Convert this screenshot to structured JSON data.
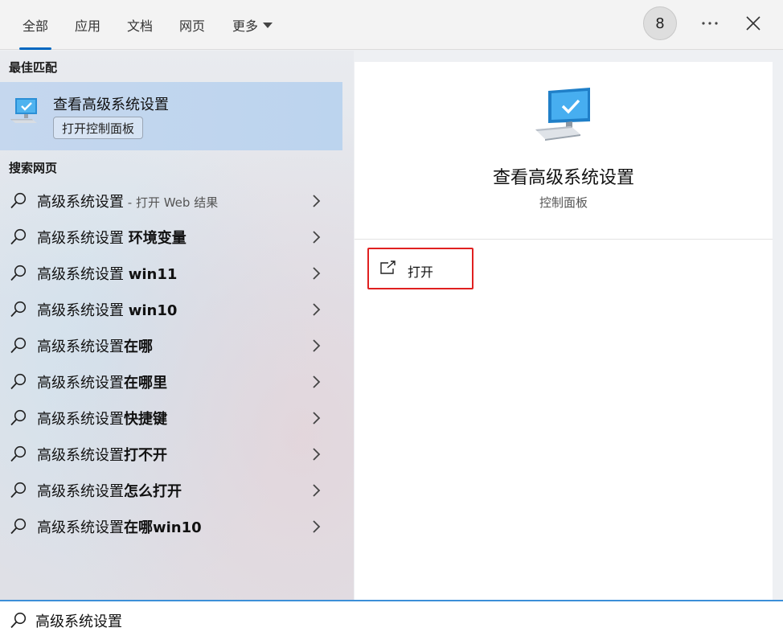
{
  "tabs": [
    {
      "label": "全部",
      "active": true
    },
    {
      "label": "应用",
      "active": false
    },
    {
      "label": "文档",
      "active": false
    },
    {
      "label": "网页",
      "active": false
    },
    {
      "label": "更多",
      "active": false
    }
  ],
  "header": {
    "account_badge": "8",
    "more_icon": "ellipsis-icon",
    "close_icon": "close-icon"
  },
  "best_match": {
    "section_title": "最佳匹配",
    "title": "查看高级系统设置",
    "subtitle": "打开控制面板",
    "icon": "monitor-check-icon"
  },
  "web_search": {
    "section_title": "搜索网页",
    "results": [
      {
        "prefix": "高级系统设置",
        "suffix": " - 打开 Web 结果",
        "bold": ""
      },
      {
        "prefix": "高级系统设置 ",
        "suffix": "",
        "bold": "环境变量"
      },
      {
        "prefix": "高级系统设置 ",
        "suffix": "",
        "bold": "win11"
      },
      {
        "prefix": "高级系统设置 ",
        "suffix": "",
        "bold": "win10"
      },
      {
        "prefix": "高级系统设置",
        "suffix": "",
        "bold": "在哪"
      },
      {
        "prefix": "高级系统设置",
        "suffix": "",
        "bold": "在哪里"
      },
      {
        "prefix": "高级系统设置",
        "suffix": "",
        "bold": "快捷键"
      },
      {
        "prefix": "高级系统设置",
        "suffix": "",
        "bold": "打不开"
      },
      {
        "prefix": "高级系统设置",
        "suffix": "",
        "bold": "怎么打开"
      },
      {
        "prefix": "高级系统设置",
        "suffix": "",
        "bold": "在哪win10"
      }
    ]
  },
  "detail": {
    "title": "查看高级系统设置",
    "subtitle": "控制面板",
    "open_label": "打开"
  },
  "search": {
    "value": "高级系统设置"
  },
  "colors": {
    "accent": "#0067c0",
    "highlight_box": "#e02020",
    "selected_bg": "#c5d7ee"
  }
}
